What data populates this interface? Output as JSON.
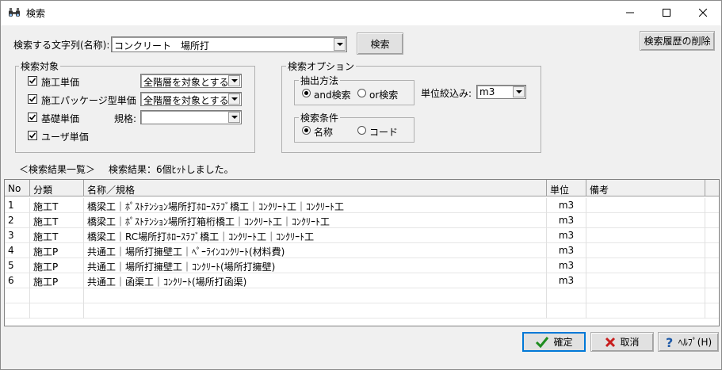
{
  "window": {
    "title": "検索",
    "icon": "binoculars-icon"
  },
  "search": {
    "label": "検索する文字列(名称):",
    "value": "コンクリート　場所打",
    "search_button": "検索",
    "history_delete_button": "検索履歴の削除"
  },
  "target": {
    "title": "検索対象",
    "items": [
      {
        "label": "施工単価",
        "checked": true,
        "scope": "全階層を対象とする"
      },
      {
        "label": "施工パッケージ型単価",
        "checked": true,
        "scope": "全階層を対象とする"
      },
      {
        "label": "基礎単価",
        "checked": true,
        "spec_label": "規格:",
        "spec_value": ""
      },
      {
        "label": "ユーザ単価",
        "checked": true
      }
    ]
  },
  "options": {
    "title": "検索オプション",
    "extract": {
      "title": "抽出方法",
      "opt1": "and検索",
      "opt2": "or検索",
      "selected": "and検索"
    },
    "unit_filter": {
      "label": "単位絞込み:",
      "value": "m3"
    },
    "condition": {
      "title": "検索条件",
      "opt1": "名称",
      "opt2": "コード",
      "selected": "名称"
    }
  },
  "results": {
    "header": "＜検索結果一覧＞",
    "summary": "検索結果：6個ﾋｯﾄしました。",
    "columns": [
      "No",
      "分類",
      "名称／規格",
      "単位",
      "備考"
    ],
    "rows": [
      {
        "no": "1",
        "category": "施工T",
        "name": "橋梁工｜ﾎﾟｽﾄﾃﾝｼｮﾝ場所打ﾎﾛｰｽﾗﾌﾞ橋工｜ｺﾝｸﾘｰﾄ工｜ｺﾝｸﾘｰﾄ工",
        "unit": "m3",
        "note": ""
      },
      {
        "no": "2",
        "category": "施工T",
        "name": "橋梁工｜ﾎﾟｽﾄﾃﾝｼｮﾝ場所打箱桁橋工｜ｺﾝｸﾘｰﾄ工｜ｺﾝｸﾘｰﾄ工",
        "unit": "m3",
        "note": ""
      },
      {
        "no": "3",
        "category": "施工T",
        "name": "橋梁工｜RC場所打ﾎﾛｰｽﾗﾌﾞ橋工｜ｺﾝｸﾘｰﾄ工｜ｺﾝｸﾘｰﾄ工",
        "unit": "m3",
        "note": ""
      },
      {
        "no": "4",
        "category": "施工P",
        "name": "共通工｜場所打擁壁工｜ﾍﾟｰﾗｲﾝｺﾝｸﾘｰﾄ(材料費)",
        "unit": "m3",
        "note": ""
      },
      {
        "no": "5",
        "category": "施工P",
        "name": "共通工｜場所打擁壁工｜ｺﾝｸﾘｰﾄ(場所打擁壁)",
        "unit": "m3",
        "note": ""
      },
      {
        "no": "6",
        "category": "施工P",
        "name": "共通工｜函渠工｜ｺﾝｸﾘｰﾄ(場所打函渠)",
        "unit": "m3",
        "note": ""
      }
    ]
  },
  "footer": {
    "ok": "確定",
    "cancel": "取消",
    "help": "ﾍﾙﾌﾟ(H)"
  },
  "colors": {
    "ok_green": "#1e8c1e",
    "cancel_red": "#c81e1e",
    "help_blue": "#1e5aa8"
  }
}
